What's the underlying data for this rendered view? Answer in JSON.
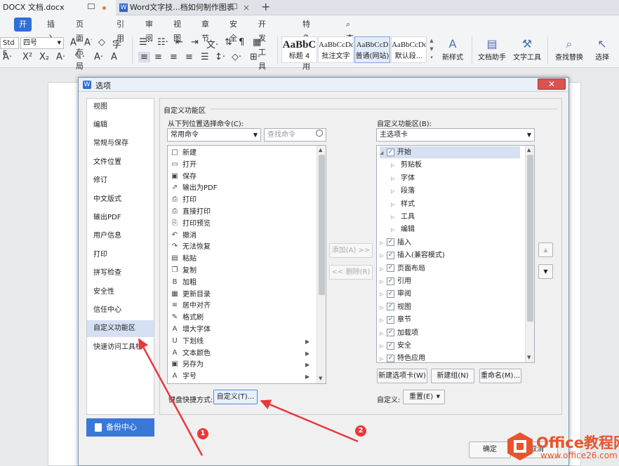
{
  "doc_tabs": [
    {
      "label": "DOCX 文档.docx"
    },
    {
      "label": "Word文字技...档如何制作图表"
    }
  ],
  "new_tab_symbol": "+",
  "ribbon": {
    "menus": [
      "开始",
      "插入",
      "页面布局",
      "引用",
      "审阅",
      "视图",
      "章节",
      "安全",
      "开发工具",
      "特色应用",
      "查找"
    ],
    "font_name": "Std F",
    "font_size": "四号",
    "styles": [
      {
        "sample": "AaBbC",
        "label": "标题 4"
      },
      {
        "sample": "AaBbCcDd",
        "label": "批注文字"
      },
      {
        "sample": "AaBbCcD",
        "label": "普通(网站)"
      },
      {
        "sample": "AaBbCcDd",
        "label": "默认段..."
      }
    ],
    "tools": [
      {
        "label": "新样式",
        "icon": "new-style-icon"
      },
      {
        "label": "文档助手",
        "icon": "doc-assistant-icon"
      },
      {
        "label": "文字工具",
        "icon": "text-tools-icon"
      },
      {
        "label": "查找替换",
        "icon": "find-replace-icon"
      },
      {
        "label": "选择",
        "icon": "select-icon"
      }
    ]
  },
  "dialog": {
    "title": "选项",
    "nav": [
      "视图",
      "编辑",
      "常规与保存",
      "文件位置",
      "修订",
      "中文版式",
      "输出PDF",
      "用户信息",
      "打印",
      "拼写检查",
      "安全性",
      "信任中心",
      "自定义功能区",
      "快速访问工具栏"
    ],
    "selected_nav": "自定义功能区",
    "backup_label": "备份中心",
    "section_title": "自定义功能区",
    "left_label": "从下列位置选择命令(C):",
    "left_combo": "常用命令",
    "search_placeholder": "查找命令",
    "commands": [
      {
        "label": "新建",
        "icon": "new-doc-icon",
        "sub": false
      },
      {
        "label": "打开",
        "icon": "open-folder-icon",
        "sub": false
      },
      {
        "label": "保存",
        "icon": "save-icon",
        "sub": false
      },
      {
        "label": "输出为PDF",
        "icon": "pdf-icon",
        "sub": false
      },
      {
        "label": "打印",
        "icon": "print-icon",
        "sub": false
      },
      {
        "label": "直接打印",
        "icon": "direct-print-icon",
        "sub": false
      },
      {
        "label": "打印预览",
        "icon": "print-preview-icon",
        "sub": false
      },
      {
        "label": "撤消",
        "icon": "undo-icon",
        "sub": false
      },
      {
        "label": "无法恢复",
        "icon": "redo-icon",
        "sub": false
      },
      {
        "label": "粘贴",
        "icon": "paste-icon",
        "sub": false
      },
      {
        "label": "复制",
        "icon": "copy-icon",
        "sub": false
      },
      {
        "label": "加粗",
        "icon": "bold-icon",
        "sub": false
      },
      {
        "label": "更新目录",
        "icon": "update-toc-icon",
        "sub": false
      },
      {
        "label": "居中对齐",
        "icon": "align-center-icon",
        "sub": false
      },
      {
        "label": "格式刷",
        "icon": "format-painter-icon",
        "sub": false
      },
      {
        "label": "增大字体",
        "icon": "grow-font-icon",
        "sub": false
      },
      {
        "label": "下划线",
        "icon": "underline-icon",
        "sub": true
      },
      {
        "label": "文本颜色",
        "icon": "font-color-icon",
        "sub": true
      },
      {
        "label": "另存为",
        "icon": "save-as-icon",
        "sub": true
      },
      {
        "label": "字号",
        "icon": "font-size-icon",
        "sub": true
      }
    ],
    "command_glyphs": [
      "□",
      "▭",
      "▣",
      "⇗",
      "⎙",
      "⎙",
      "⎘",
      "↶",
      "↷",
      "▤",
      "❐",
      "B",
      "▦",
      "≡",
      "✎",
      "A",
      "U",
      "A",
      "▣",
      "A"
    ],
    "add_button": "添加(A) >>",
    "remove_button": "<< 删除(R)",
    "right_label": "自定义功能区(B):",
    "right_combo": "主选项卡",
    "tree": [
      {
        "label": "开始",
        "level": 0,
        "checked": true,
        "expanded": true
      },
      {
        "label": "剪贴板",
        "level": 1,
        "checked": false,
        "expanded": false
      },
      {
        "label": "字体",
        "level": 1,
        "checked": false,
        "expanded": false
      },
      {
        "label": "段落",
        "level": 1,
        "checked": false,
        "expanded": false
      },
      {
        "label": "样式",
        "level": 1,
        "checked": false,
        "expanded": false
      },
      {
        "label": "工具",
        "level": 1,
        "checked": false,
        "expanded": false
      },
      {
        "label": "编辑",
        "level": 1,
        "checked": false,
        "expanded": false
      },
      {
        "label": "插入",
        "level": 0,
        "checked": true,
        "expanded": false
      },
      {
        "label": "插入(兼容模式)",
        "level": 0,
        "checked": true,
        "expanded": false
      },
      {
        "label": "页面布局",
        "level": 0,
        "checked": true,
        "expanded": false
      },
      {
        "label": "引用",
        "level": 0,
        "checked": true,
        "expanded": false
      },
      {
        "label": "审阅",
        "level": 0,
        "checked": true,
        "expanded": false
      },
      {
        "label": "视图",
        "level": 0,
        "checked": true,
        "expanded": false
      },
      {
        "label": "章节",
        "level": 0,
        "checked": true,
        "expanded": false
      },
      {
        "label": "加载项",
        "level": 0,
        "checked": true,
        "expanded": false
      },
      {
        "label": "安全",
        "level": 0,
        "checked": true,
        "expanded": false
      },
      {
        "label": "特色应用",
        "level": 0,
        "checked": true,
        "expanded": false
      }
    ],
    "new_tab_button": "新建选项卡(W)",
    "new_group_button": "新建组(N)",
    "rename_button": "重命名(M)...",
    "shortcut_label": "键盘快捷方式:",
    "customize_button": "自定义(T)...",
    "custom_label": "自定义:",
    "reset_button": "重置(E)",
    "ok_button": "确定",
    "cancel_button": "取消"
  },
  "annotations": [
    {
      "number": "1"
    },
    {
      "number": "2"
    }
  ],
  "watermark": {
    "title": "Office教程网",
    "url": "www.office26.com"
  },
  "colors": {
    "accent": "#2f6fd6",
    "annotation": "#e8393a",
    "watermark": "#e8542c"
  }
}
